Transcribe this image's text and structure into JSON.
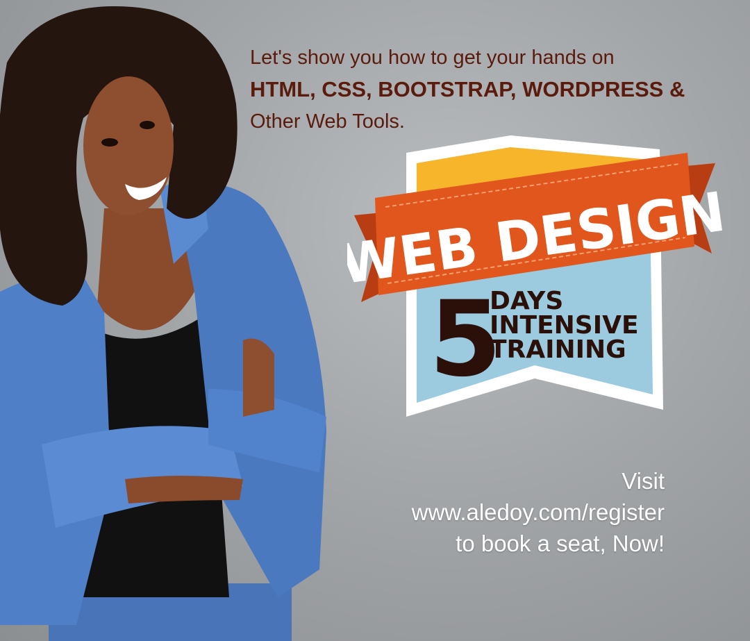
{
  "headline": {
    "line1": "Let's show you how to get your hands on",
    "line2": "HTML, CSS, BOOTSTRAP, WORDPRESS &",
    "line3": "Other Web Tools."
  },
  "badge": {
    "banner_text": "WEB DESIGN",
    "number": "5",
    "line1": "DAYS",
    "line2": "INTENSIVE",
    "line3": "TRAINING"
  },
  "cta": {
    "line1": "Visit",
    "line2": "www.aledoy.com/register",
    "line3": "to book a seat, Now!"
  },
  "colors": {
    "background": "#a3a6a9",
    "headline": "#5a1a0c",
    "ribbon": "#e0561c",
    "badge_blue": "#9ccbe0",
    "badge_yellow": "#f6b52a",
    "number_text": "#2a1008",
    "cta_text": "#ffffff"
  }
}
